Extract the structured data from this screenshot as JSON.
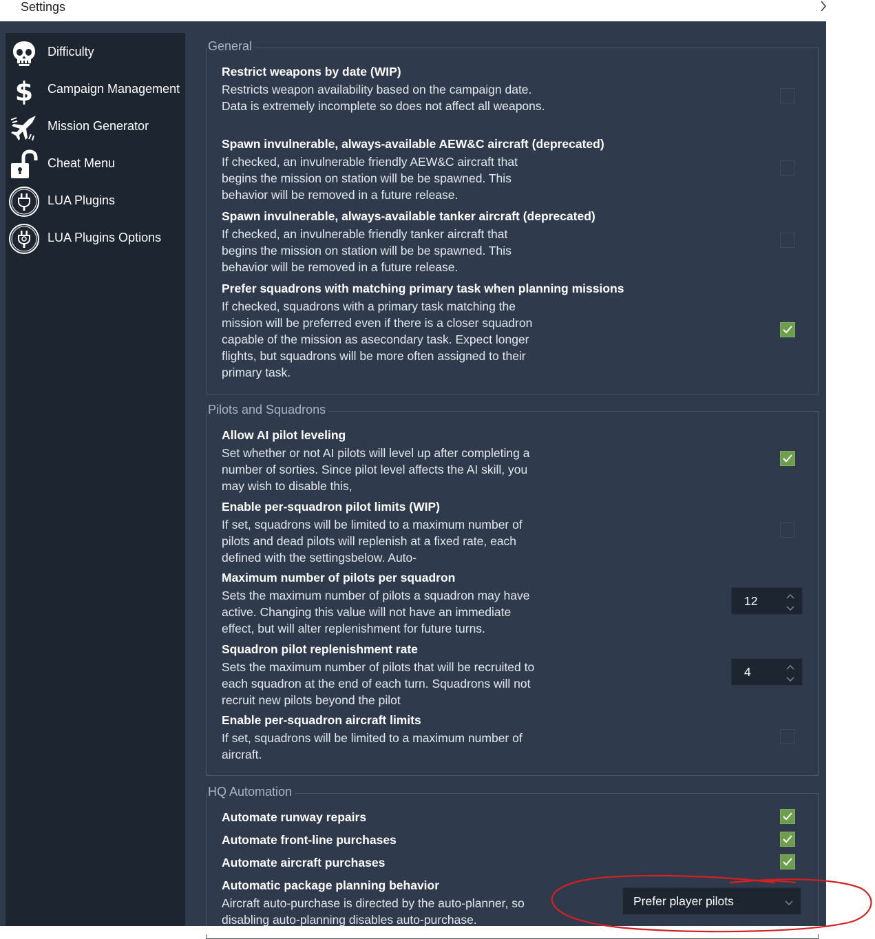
{
  "window": {
    "title": "Settings",
    "expand_icon": "chevron-right-icon"
  },
  "colors": {
    "background": "#2f3b4c",
    "sidebar": "#1c2530",
    "checkbox_on": "#6c9e4d",
    "annotation": "#d42020"
  },
  "sidebar": {
    "items": [
      {
        "label": "Difficulty",
        "icon": "skull-icon"
      },
      {
        "label": "Campaign Management",
        "icon": "dollar-icon"
      },
      {
        "label": "Mission Generator",
        "icon": "jet-icon"
      },
      {
        "label": "Cheat Menu",
        "icon": "unlock-icon"
      },
      {
        "label": "LUA Plugins",
        "icon": "plug-icon"
      },
      {
        "label": "LUA Plugins Options",
        "icon": "plug-settings-icon"
      }
    ]
  },
  "general": {
    "title": "General",
    "items": [
      {
        "title": "Restrict weapons by date (WIP)",
        "desc": "Restricts weapon availability based on the campaign date. Data is extremely incomplete so does not affect all weapons.",
        "checked": false
      },
      {
        "title": "Spawn invulnerable, always-available AEW&C aircraft (deprecated)",
        "desc": "If checked, an invulnerable friendly AEW&C aircraft that begins the mission on station will be be spawned. This behavior will be removed in a future release.",
        "checked": false
      },
      {
        "title": "Spawn invulnerable, always-available tanker aircraft (deprecated)",
        "desc": "If checked, an invulnerable friendly tanker aircraft that begins the mission on station will be be spawned. This behavior will be removed in a future release.",
        "checked": false
      },
      {
        "title": "Prefer squadrons with matching primary task when planning missions",
        "desc": "If checked, squadrons with a primary task matching the mission will be preferred even if there is a closer squadron capable of the mission as asecondary task. Expect longer flights, but squadrons will be more often assigned to their primary task.",
        "checked": true
      }
    ]
  },
  "pilots": {
    "title": "Pilots and Squadrons",
    "items": [
      {
        "title": "Allow AI pilot leveling",
        "desc": "Set whether or not AI pilots will level up after completing a number of sorties. Since pilot level affects the AI skill, you may wish to disable this,",
        "checked": true
      },
      {
        "title": "Enable per-squadron pilot limits (WIP)",
        "desc": "If set, squadrons will be limited to a maximum number of pilots and dead pilots will replenish at a fixed rate, each defined with the settingsbelow. Auto-",
        "checked": false
      },
      {
        "title": "Maximum number of pilots per squadron",
        "desc": "Sets the maximum number of pilots a squadron may have active. Changing this value will not have an immediate effect, but will alter replenishment for future turns.",
        "value": "12"
      },
      {
        "title": "Squadron pilot replenishment rate",
        "desc": "Sets the maximum number of pilots that will be recruited to each squadron at the end of each turn. Squadrons will not recruit new pilots beyond the pilot",
        "value": "4"
      },
      {
        "title": "Enable per-squadron aircraft limits",
        "desc": "If set, squadrons will be limited to a maximum number of aircraft.",
        "checked": false
      }
    ]
  },
  "hq": {
    "title": "HQ Automation",
    "items": [
      {
        "title": "Automate runway repairs",
        "checked": true
      },
      {
        "title": "Automate front-line purchases",
        "checked": true
      },
      {
        "title": "Automate aircraft purchases",
        "checked": true
      },
      {
        "title": "Automatic package planning behavior",
        "desc": "Aircraft auto-purchase is directed by the auto-planner, so disabling auto-planning disables auto-purchase.",
        "selected": "Prefer player pilots"
      }
    ]
  }
}
